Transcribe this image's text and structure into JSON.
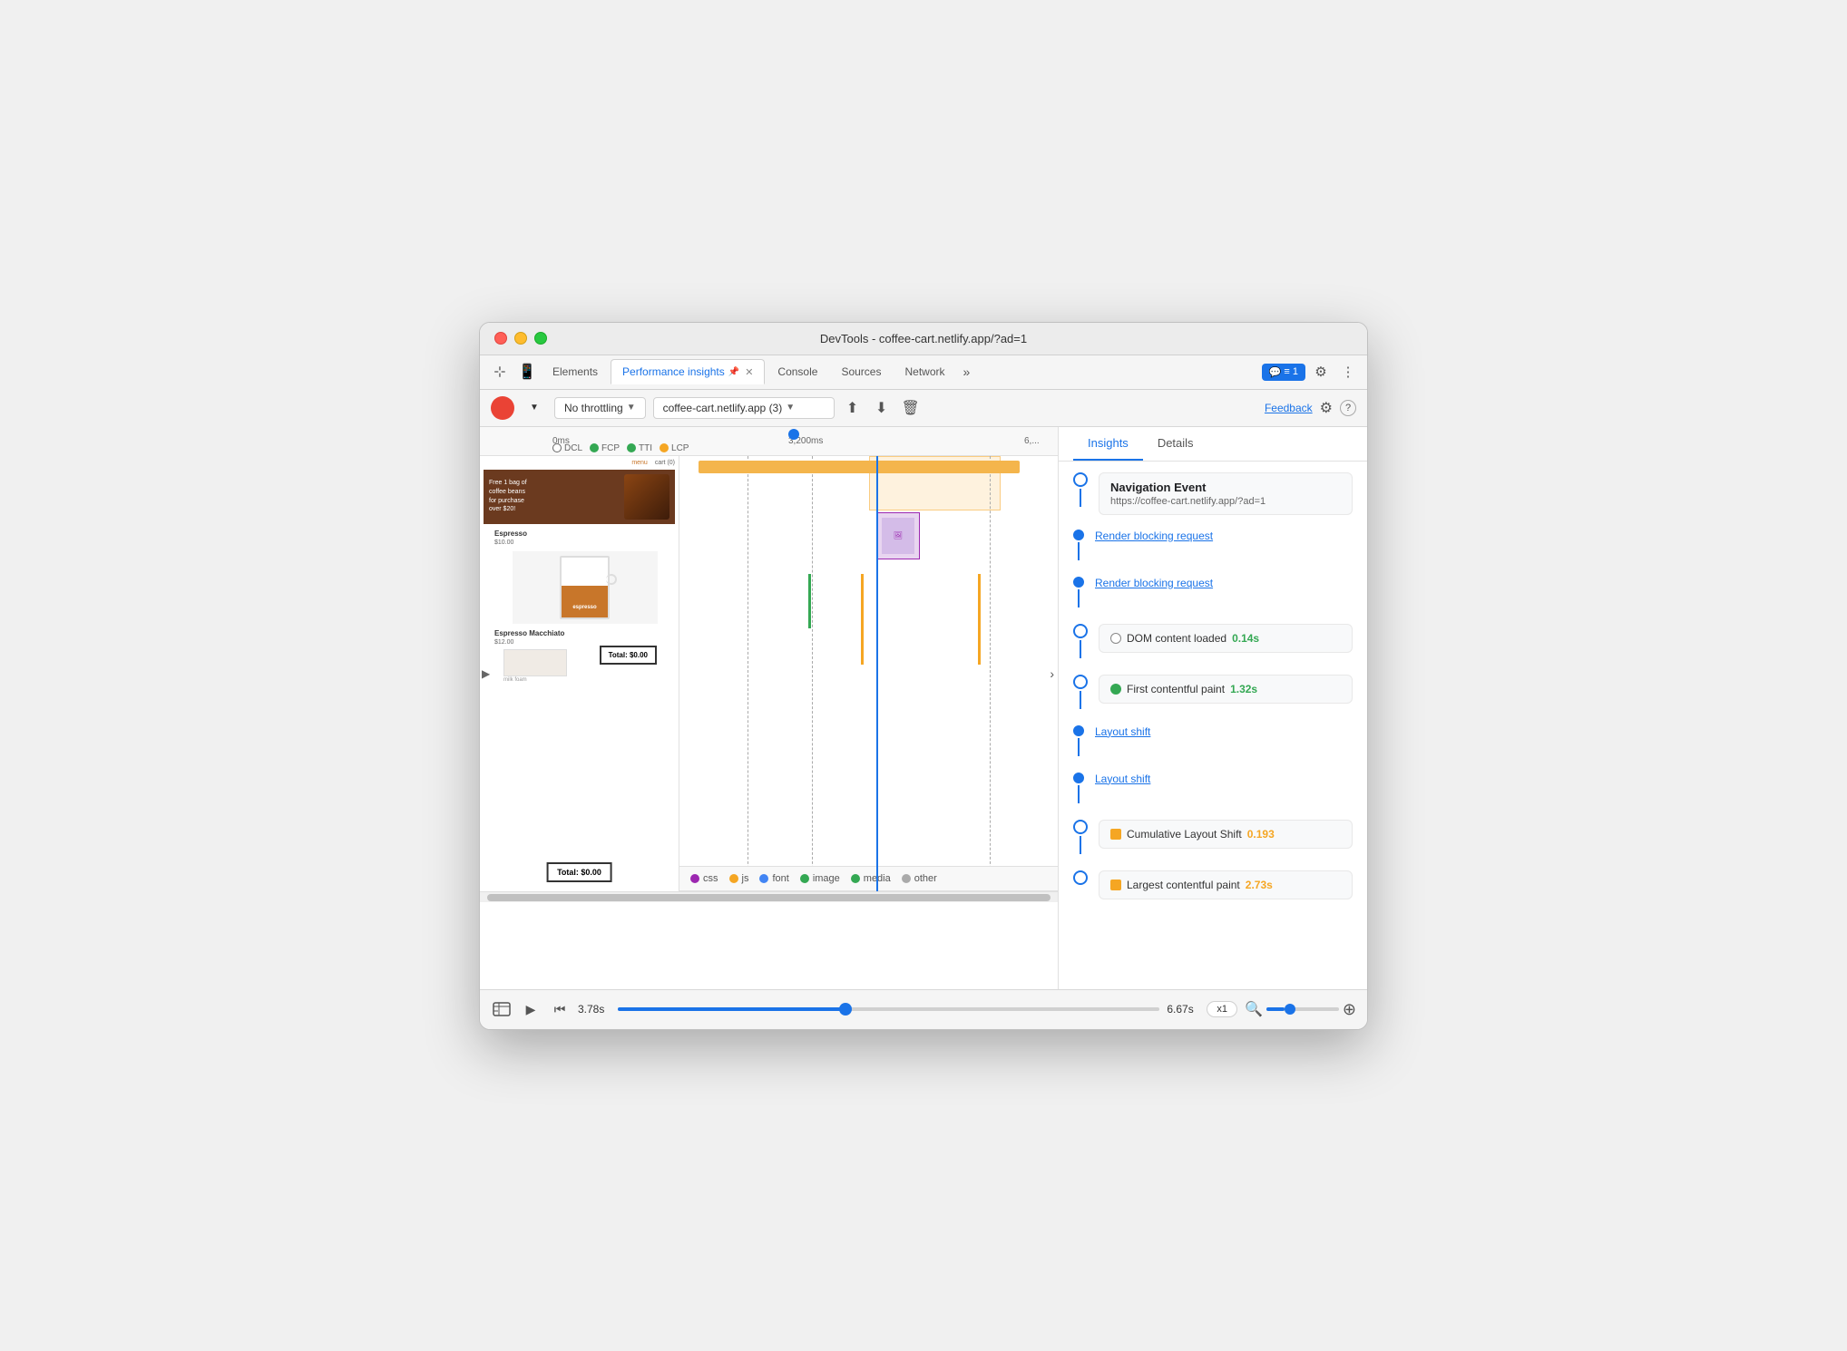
{
  "window": {
    "title": "DevTools - coffee-cart.netlify.app/?ad=1"
  },
  "tabs": [
    {
      "label": "Elements",
      "active": false
    },
    {
      "label": "Performance insights",
      "active": true,
      "pinned": true,
      "closable": true
    },
    {
      "label": "Console",
      "active": false
    },
    {
      "label": "Sources",
      "active": false
    },
    {
      "label": "Network",
      "active": false
    }
  ],
  "tab_more": "»",
  "devtools_badge": "≡ 1",
  "toolbar": {
    "throttle_label": "No throttling",
    "url_label": "coffee-cart.netlify.app (3)",
    "feedback_label": "Feedback"
  },
  "time_ruler": {
    "start": "0ms",
    "mid": "3,200ms",
    "end": "6,..."
  },
  "metrics_legend": {
    "dcl": "DCL",
    "fcp": "FCP",
    "tti": "TTI",
    "lcp": "LCP"
  },
  "legend": {
    "items": [
      {
        "label": "css",
        "color": "#9c27b0"
      },
      {
        "label": "js",
        "color": "#f5a623"
      },
      {
        "label": "font",
        "color": "#4285f4"
      },
      {
        "label": "image",
        "color": "#34a853"
      },
      {
        "label": "media",
        "color": "#34a853"
      },
      {
        "label": "other",
        "color": "#aaa"
      }
    ]
  },
  "insights_panel": {
    "tabs": [
      "Insights",
      "Details"
    ],
    "active_tab": "Insights"
  },
  "timeline_items": [
    {
      "type": "navigation",
      "title": "Navigation Event",
      "url": "https://coffee-cart.netlify.app/?ad=1"
    },
    {
      "type": "link",
      "label": "Render blocking request"
    },
    {
      "type": "link",
      "label": "Render blocking request"
    },
    {
      "type": "metric",
      "label": "DOM content loaded",
      "value": "0.14s",
      "color": "circle"
    },
    {
      "type": "metric",
      "label": "First contentful paint",
      "value": "1.32s",
      "color": "green"
    },
    {
      "type": "link",
      "label": "Layout shift"
    },
    {
      "type": "link",
      "label": "Layout shift"
    },
    {
      "type": "metric",
      "label": "Cumulative Layout Shift",
      "value": "0.193",
      "color": "orange",
      "icon": true
    },
    {
      "type": "metric",
      "label": "Largest contentful paint",
      "value": "2.73s",
      "color": "orange",
      "icon": true
    }
  ],
  "bottom_bar": {
    "time_current": "3.78s",
    "time_end": "6.67s",
    "speed": "x1"
  }
}
